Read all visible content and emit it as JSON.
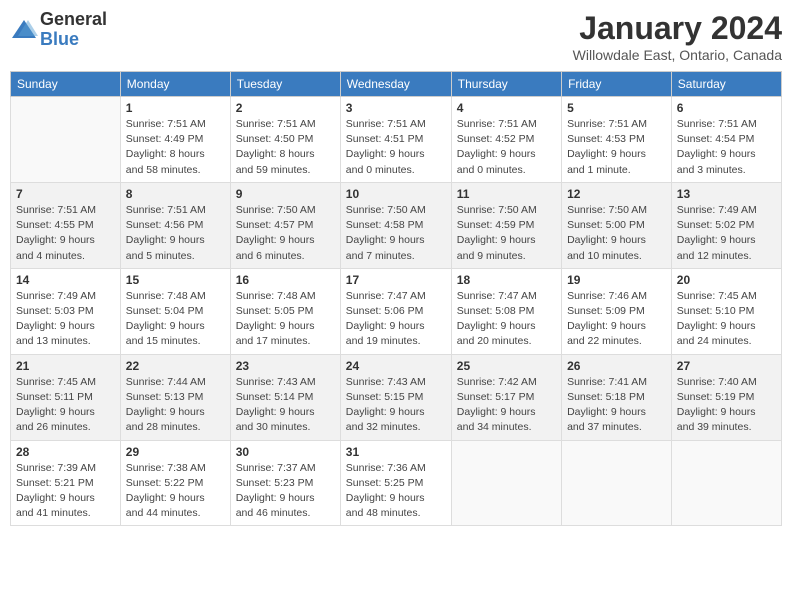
{
  "header": {
    "logo_line1": "General",
    "logo_line2": "Blue",
    "month": "January 2024",
    "location": "Willowdale East, Ontario, Canada"
  },
  "days_of_week": [
    "Sunday",
    "Monday",
    "Tuesday",
    "Wednesday",
    "Thursday",
    "Friday",
    "Saturday"
  ],
  "weeks": [
    [
      {
        "day": "",
        "detail": ""
      },
      {
        "day": "1",
        "detail": "Sunrise: 7:51 AM\nSunset: 4:49 PM\nDaylight: 8 hours\nand 58 minutes."
      },
      {
        "day": "2",
        "detail": "Sunrise: 7:51 AM\nSunset: 4:50 PM\nDaylight: 8 hours\nand 59 minutes."
      },
      {
        "day": "3",
        "detail": "Sunrise: 7:51 AM\nSunset: 4:51 PM\nDaylight: 9 hours\nand 0 minutes."
      },
      {
        "day": "4",
        "detail": "Sunrise: 7:51 AM\nSunset: 4:52 PM\nDaylight: 9 hours\nand 0 minutes."
      },
      {
        "day": "5",
        "detail": "Sunrise: 7:51 AM\nSunset: 4:53 PM\nDaylight: 9 hours\nand 1 minute."
      },
      {
        "day": "6",
        "detail": "Sunrise: 7:51 AM\nSunset: 4:54 PM\nDaylight: 9 hours\nand 3 minutes."
      }
    ],
    [
      {
        "day": "7",
        "detail": "Sunrise: 7:51 AM\nSunset: 4:55 PM\nDaylight: 9 hours\nand 4 minutes."
      },
      {
        "day": "8",
        "detail": "Sunrise: 7:51 AM\nSunset: 4:56 PM\nDaylight: 9 hours\nand 5 minutes."
      },
      {
        "day": "9",
        "detail": "Sunrise: 7:50 AM\nSunset: 4:57 PM\nDaylight: 9 hours\nand 6 minutes."
      },
      {
        "day": "10",
        "detail": "Sunrise: 7:50 AM\nSunset: 4:58 PM\nDaylight: 9 hours\nand 7 minutes."
      },
      {
        "day": "11",
        "detail": "Sunrise: 7:50 AM\nSunset: 4:59 PM\nDaylight: 9 hours\nand 9 minutes."
      },
      {
        "day": "12",
        "detail": "Sunrise: 7:50 AM\nSunset: 5:00 PM\nDaylight: 9 hours\nand 10 minutes."
      },
      {
        "day": "13",
        "detail": "Sunrise: 7:49 AM\nSunset: 5:02 PM\nDaylight: 9 hours\nand 12 minutes."
      }
    ],
    [
      {
        "day": "14",
        "detail": "Sunrise: 7:49 AM\nSunset: 5:03 PM\nDaylight: 9 hours\nand 13 minutes."
      },
      {
        "day": "15",
        "detail": "Sunrise: 7:48 AM\nSunset: 5:04 PM\nDaylight: 9 hours\nand 15 minutes."
      },
      {
        "day": "16",
        "detail": "Sunrise: 7:48 AM\nSunset: 5:05 PM\nDaylight: 9 hours\nand 17 minutes."
      },
      {
        "day": "17",
        "detail": "Sunrise: 7:47 AM\nSunset: 5:06 PM\nDaylight: 9 hours\nand 19 minutes."
      },
      {
        "day": "18",
        "detail": "Sunrise: 7:47 AM\nSunset: 5:08 PM\nDaylight: 9 hours\nand 20 minutes."
      },
      {
        "day": "19",
        "detail": "Sunrise: 7:46 AM\nSunset: 5:09 PM\nDaylight: 9 hours\nand 22 minutes."
      },
      {
        "day": "20",
        "detail": "Sunrise: 7:45 AM\nSunset: 5:10 PM\nDaylight: 9 hours\nand 24 minutes."
      }
    ],
    [
      {
        "day": "21",
        "detail": "Sunrise: 7:45 AM\nSunset: 5:11 PM\nDaylight: 9 hours\nand 26 minutes."
      },
      {
        "day": "22",
        "detail": "Sunrise: 7:44 AM\nSunset: 5:13 PM\nDaylight: 9 hours\nand 28 minutes."
      },
      {
        "day": "23",
        "detail": "Sunrise: 7:43 AM\nSunset: 5:14 PM\nDaylight: 9 hours\nand 30 minutes."
      },
      {
        "day": "24",
        "detail": "Sunrise: 7:43 AM\nSunset: 5:15 PM\nDaylight: 9 hours\nand 32 minutes."
      },
      {
        "day": "25",
        "detail": "Sunrise: 7:42 AM\nSunset: 5:17 PM\nDaylight: 9 hours\nand 34 minutes."
      },
      {
        "day": "26",
        "detail": "Sunrise: 7:41 AM\nSunset: 5:18 PM\nDaylight: 9 hours\nand 37 minutes."
      },
      {
        "day": "27",
        "detail": "Sunrise: 7:40 AM\nSunset: 5:19 PM\nDaylight: 9 hours\nand 39 minutes."
      }
    ],
    [
      {
        "day": "28",
        "detail": "Sunrise: 7:39 AM\nSunset: 5:21 PM\nDaylight: 9 hours\nand 41 minutes."
      },
      {
        "day": "29",
        "detail": "Sunrise: 7:38 AM\nSunset: 5:22 PM\nDaylight: 9 hours\nand 44 minutes."
      },
      {
        "day": "30",
        "detail": "Sunrise: 7:37 AM\nSunset: 5:23 PM\nDaylight: 9 hours\nand 46 minutes."
      },
      {
        "day": "31",
        "detail": "Sunrise: 7:36 AM\nSunset: 5:25 PM\nDaylight: 9 hours\nand 48 minutes."
      },
      {
        "day": "",
        "detail": ""
      },
      {
        "day": "",
        "detail": ""
      },
      {
        "day": "",
        "detail": ""
      }
    ]
  ]
}
